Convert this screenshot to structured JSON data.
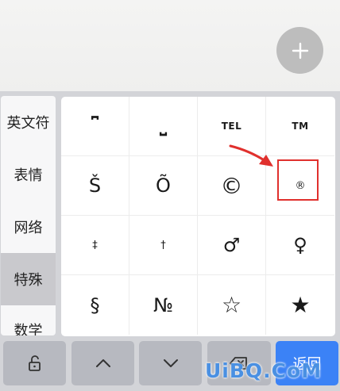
{
  "categories": [
    {
      "label": "英文符",
      "active": false
    },
    {
      "label": "表情",
      "active": false
    },
    {
      "label": "网络",
      "active": false
    },
    {
      "label": "特殊",
      "active": true
    },
    {
      "label": "数学",
      "active": false
    }
  ],
  "symbols": [
    [
      "⎴",
      "⎵",
      "TEL",
      "TM"
    ],
    [
      "Š",
      "Õ",
      "©",
      "®"
    ],
    [
      "‡",
      "†",
      "♂",
      "♀"
    ],
    [
      "§",
      "№",
      "☆",
      "★"
    ]
  ],
  "bottom_bar": {
    "lock_icon": "unlock-icon",
    "up_icon": "chevron-up-icon",
    "down_icon": "chevron-down-icon",
    "delete_icon": "backspace-icon",
    "return_label": "返回"
  },
  "watermark": "UiBQ.CoM",
  "colors": {
    "highlight": "#e0302d",
    "return_key": "#3b82f6",
    "watermark": "#4a90e2"
  }
}
